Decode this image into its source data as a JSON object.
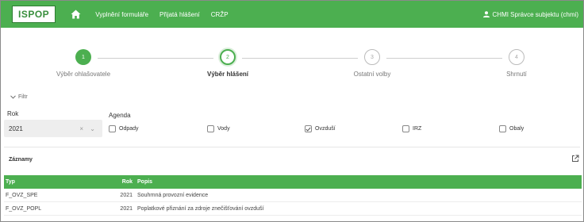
{
  "topbar": {
    "logo": "ISPOP",
    "home_icon": "home-icon",
    "nav": [
      "Vyplnění formuláře",
      "Přijatá hlášení",
      "CRŽP"
    ],
    "user_icon": "user-icon",
    "user": "CHMI Správce subjektu (chmi)"
  },
  "stepper": {
    "steps": [
      {
        "number": "1",
        "label": "Výběr ohlašovatele",
        "state": "done"
      },
      {
        "number": "2",
        "label": "Výběr hlášení",
        "state": "active"
      },
      {
        "number": "3",
        "label": "Ostatní volby",
        "state": "todo"
      },
      {
        "number": "4",
        "label": "Shrnutí",
        "state": "todo"
      }
    ]
  },
  "filter": {
    "toggle_icon": "chevron-down-icon",
    "title": "Filtr",
    "rok_label": "Rok",
    "rok_value": "2021",
    "rok_controls": "× ⌄",
    "agenda_label": "Agenda",
    "agenda": [
      {
        "label": "Odpady",
        "checked": false
      },
      {
        "label": "Vody",
        "checked": false
      },
      {
        "label": "Ovzduší",
        "checked": true
      },
      {
        "label": "IRZ",
        "checked": false
      },
      {
        "label": "Obaly",
        "checked": false
      }
    ]
  },
  "records": {
    "title": "Záznamy",
    "export_icon": "external-link-icon",
    "columns": [
      "Typ",
      "Rok",
      "Popis"
    ],
    "rows": [
      {
        "typ": "F_OVZ_SPE",
        "rok": "2021",
        "popis": "Souhrnná provozní evidence"
      },
      {
        "typ": "F_OVZ_POPL",
        "rok": "2021",
        "popis": "Poplatkové přiznání za zdroje znečišťování ovzduší"
      }
    ]
  },
  "colors": {
    "brand_green": "#4caf50",
    "logo_green": "#388e3c"
  }
}
